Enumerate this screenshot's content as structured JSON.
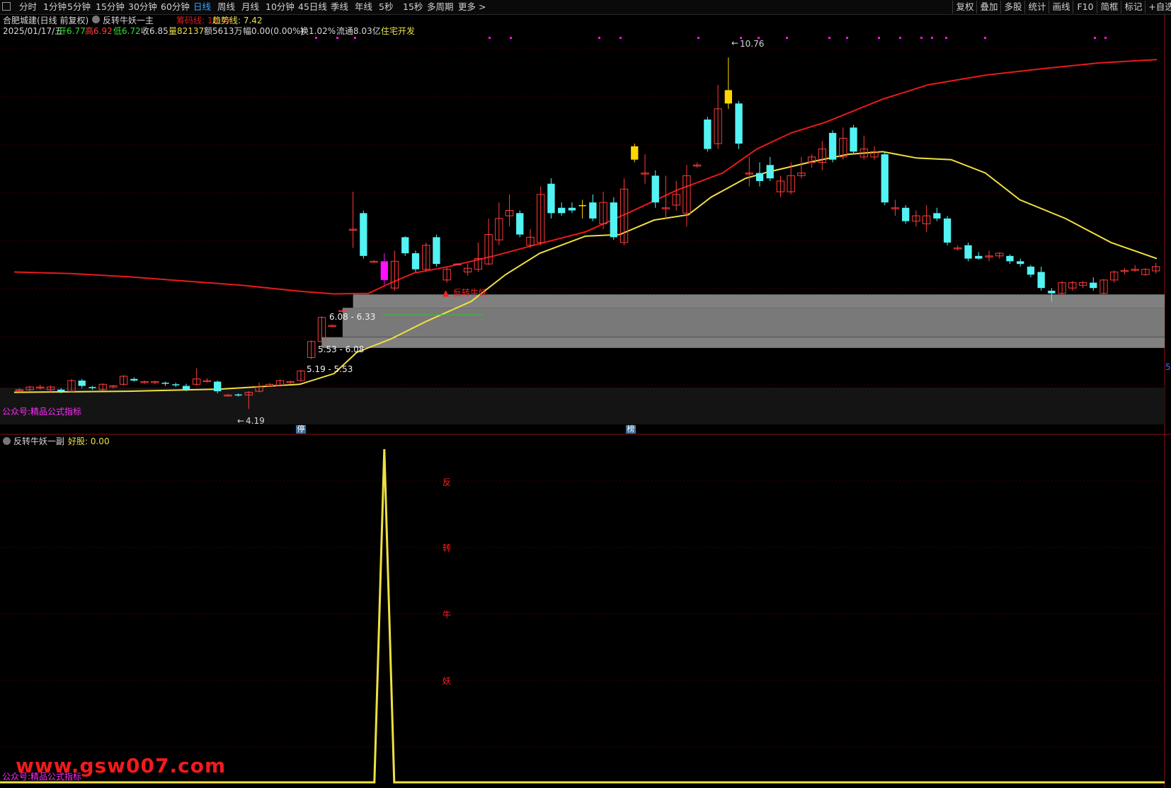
{
  "toolbar": {
    "periods": [
      "分时",
      "1分钟",
      "5分钟",
      "15分钟",
      "30分钟",
      "60分钟",
      "日线",
      "周线",
      "月线",
      "10分钟",
      "45日线",
      "季线",
      "年线",
      "5秒",
      "15秒",
      "多周期",
      "更多 >"
    ],
    "active_period": "日线",
    "right_buttons": [
      "复权",
      "叠加",
      "多股",
      "统计",
      "画线",
      "F10",
      "简框",
      "标记",
      "+自选"
    ]
  },
  "header": {
    "stock": "合肥城建(日线 前复权)",
    "indicator": "反转牛妖一主",
    "cost_label": "筹码线: 10.47",
    "trend_label": "趋势线: 7.42"
  },
  "quote": {
    "date": "2025/01/17/五",
    "open": "开6.77",
    "high": "高6.92",
    "low": "低6.72",
    "close": "收6.85",
    "volume": "量82137",
    "amount": "额5613万",
    "change": "幅0.00(0.00%)",
    "turnover": "换1.02%",
    "float_cap": "流通8.03亿",
    "sector": "住宅开发"
  },
  "annotations": {
    "peak_price": "10.76",
    "low_price": "4.19",
    "signal_label": "反转牛妖",
    "zone_top_label": "6.08 - 6.33",
    "zone_mid_label": "5.53 - 6.08",
    "zone_low_label": "5.19 - 5.53",
    "axis_marker_left": "停",
    "axis_marker_right": "榜",
    "right_edge": "5",
    "watermark_main": "公众号:精品公式指标"
  },
  "sub_panel": {
    "title": "反转牛妖一副",
    "value_label": "好股: 0.00",
    "spike_chars": [
      "反",
      "转",
      "牛",
      "妖"
    ],
    "watermark": "公众号:精品公式指标"
  },
  "site_watermark": "www.gsw007.com",
  "colors": {
    "up": "#ff3b3b",
    "down": "#53f3f3",
    "cost_line": "#e81a1a",
    "trend_line": "#f0e040",
    "highlight_yellow": "#ffd700",
    "highlight_magenta": "#ff10ff",
    "zone_gray": "#808080"
  },
  "chart_data": {
    "type": "candlestick",
    "price_range": [
      3.9,
      11.2
    ],
    "candles": [
      [
        4.55,
        4.55,
        4.5,
        4.58
      ],
      [
        4.55,
        4.6,
        4.52,
        4.62
      ],
      [
        4.6,
        4.6,
        4.55,
        4.64
      ],
      [
        4.55,
        4.6,
        4.5,
        4.63
      ],
      [
        4.55,
        4.52,
        4.48,
        4.58
      ],
      [
        4.52,
        4.72,
        4.5,
        4.75
      ],
      [
        4.72,
        4.62,
        4.58,
        4.75
      ],
      [
        4.6,
        4.58,
        4.55,
        4.62
      ],
      [
        4.55,
        4.65,
        4.53,
        4.67
      ],
      [
        4.6,
        4.62,
        4.57,
        4.64
      ],
      [
        4.65,
        4.8,
        4.62,
        4.82
      ],
      [
        4.75,
        4.72,
        4.7,
        4.78
      ],
      [
        4.7,
        4.7,
        4.66,
        4.72
      ],
      [
        4.68,
        4.7,
        4.65,
        4.72
      ],
      [
        4.68,
        4.66,
        4.62,
        4.7
      ],
      [
        4.65,
        4.64,
        4.6,
        4.68
      ],
      [
        4.62,
        4.55,
        4.52,
        4.66
      ],
      [
        4.65,
        4.75,
        4.62,
        4.95
      ],
      [
        4.72,
        4.72,
        4.68,
        4.76
      ],
      [
        4.7,
        4.52,
        4.48,
        4.72
      ],
      [
        4.45,
        4.45,
        4.42,
        4.47
      ],
      [
        4.46,
        4.45,
        4.42,
        4.48
      ],
      [
        4.45,
        4.5,
        4.19,
        4.52
      ],
      [
        4.52,
        4.6,
        4.5,
        4.68
      ],
      [
        4.62,
        4.65,
        4.6,
        4.67
      ],
      [
        4.62,
        4.72,
        4.6,
        4.74
      ],
      [
        4.68,
        4.7,
        4.66,
        4.72
      ],
      [
        4.72,
        4.9,
        4.7,
        4.92
      ],
      [
        5.15,
        5.45,
        5.12,
        5.47
      ],
      [
        5.45,
        5.9,
        5.43,
        5.92
      ],
      [
        5.75,
        5.75,
        5.73,
        5.77
      ],
      [
        6.03,
        6.03,
        6.01,
        6.05
      ],
      [
        7.55,
        7.55,
        7.2,
        8.25
      ],
      [
        7.85,
        7.05,
        7.0,
        7.9
      ],
      [
        6.95,
        6.95,
        6.93,
        6.97
      ],
      [
        6.6,
        6.95,
        6.5,
        7.1
      ],
      [
        6.45,
        6.95,
        6.4,
        7.15
      ],
      [
        7.4,
        7.1,
        7.05,
        7.42
      ],
      [
        7.1,
        6.8,
        6.75,
        7.15
      ],
      [
        6.8,
        7.25,
        6.75,
        7.3
      ],
      [
        7.4,
        6.9,
        6.85,
        7.45
      ],
      [
        6.6,
        6.8,
        6.55,
        6.85
      ],
      [
        6.9,
        6.9,
        6.88,
        6.92
      ],
      [
        6.75,
        6.82,
        6.68,
        6.9
      ],
      [
        6.8,
        7.0,
        6.75,
        7.3
      ],
      [
        6.9,
        7.45,
        6.88,
        7.75
      ],
      [
        7.35,
        7.75,
        7.25,
        8.05
      ],
      [
        7.8,
        7.9,
        7.6,
        8.2
      ],
      [
        7.85,
        7.45,
        7.4,
        7.9
      ],
      [
        7.25,
        7.4,
        7.2,
        7.55
      ],
      [
        7.3,
        8.2,
        7.25,
        8.35
      ],
      [
        8.4,
        7.85,
        7.75,
        8.5
      ],
      [
        7.95,
        7.85,
        7.8,
        8.05
      ],
      [
        7.95,
        7.9,
        7.85,
        8.05
      ],
      [
        8.0,
        8.0,
        7.75,
        8.1
      ],
      [
        8.05,
        7.75,
        7.7,
        8.2
      ],
      [
        7.65,
        8.05,
        7.55,
        8.25
      ],
      [
        8.05,
        7.4,
        7.35,
        8.15
      ],
      [
        7.3,
        8.3,
        7.25,
        8.5
      ],
      [
        9.1,
        8.85,
        8.8,
        9.15
      ],
      [
        8.6,
        8.6,
        8.4,
        8.95
      ],
      [
        8.55,
        8.05,
        7.95,
        8.65
      ],
      [
        7.95,
        7.95,
        7.75,
        8.55
      ],
      [
        8.0,
        8.2,
        7.9,
        8.45
      ],
      [
        7.85,
        8.55,
        7.6,
        8.75
      ],
      [
        8.75,
        8.75,
        8.7,
        8.8
      ],
      [
        9.6,
        9.05,
        9.0,
        9.65
      ],
      [
        9.15,
        9.8,
        9.05,
        10.25
      ],
      [
        9.9,
        10.15,
        9.8,
        10.76
      ],
      [
        9.9,
        9.15,
        9.05,
        9.95
      ],
      [
        8.6,
        8.6,
        8.35,
        8.9
      ],
      [
        8.6,
        8.45,
        8.35,
        8.8
      ],
      [
        8.75,
        8.5,
        8.45,
        8.9
      ],
      [
        8.25,
        8.45,
        8.15,
        8.55
      ],
      [
        8.25,
        8.55,
        8.2,
        8.8
      ],
      [
        8.55,
        8.6,
        8.5,
        8.9
      ],
      [
        8.8,
        8.9,
        8.7,
        8.95
      ],
      [
        8.8,
        9.05,
        8.65,
        9.2
      ],
      [
        9.35,
        8.85,
        8.8,
        9.4
      ],
      [
        8.9,
        9.25,
        8.85,
        9.45
      ],
      [
        9.45,
        9.0,
        8.95,
        9.5
      ],
      [
        8.9,
        9.05,
        8.85,
        9.3
      ],
      [
        8.9,
        9.0,
        8.85,
        9.1
      ],
      [
        8.95,
        8.05,
        8.0,
        9.0
      ],
      [
        7.95,
        7.95,
        7.8,
        8.1
      ],
      [
        7.95,
        7.7,
        7.65,
        8.0
      ],
      [
        7.7,
        7.8,
        7.6,
        7.9
      ],
      [
        7.65,
        7.8,
        7.5,
        8.0
      ],
      [
        7.85,
        7.75,
        7.7,
        7.95
      ],
      [
        7.75,
        7.3,
        7.25,
        7.8
      ],
      [
        7.2,
        7.2,
        7.15,
        7.25
      ],
      [
        7.25,
        7.0,
        6.95,
        7.3
      ],
      [
        7.05,
        7.0,
        6.98,
        7.12
      ],
      [
        7.05,
        7.05,
        6.95,
        7.15
      ],
      [
        7.05,
        7.1,
        7.0,
        7.12
      ],
      [
        7.05,
        6.95,
        6.9,
        7.08
      ],
      [
        6.95,
        6.9,
        6.85,
        7.0
      ],
      [
        6.85,
        6.7,
        6.65,
        6.88
      ],
      [
        6.75,
        6.45,
        6.4,
        6.85
      ],
      [
        6.4,
        6.35,
        6.2,
        6.45
      ],
      [
        6.35,
        6.55,
        6.3,
        6.58
      ],
      [
        6.45,
        6.55,
        6.4,
        6.58
      ],
      [
        6.5,
        6.55,
        6.45,
        6.58
      ],
      [
        6.55,
        6.45,
        6.4,
        6.65
      ],
      [
        6.35,
        6.6,
        6.3,
        6.62
      ],
      [
        6.6,
        6.75,
        6.55,
        6.78
      ],
      [
        6.78,
        6.78,
        6.7,
        6.82
      ],
      [
        6.8,
        6.8,
        6.75,
        6.88
      ],
      [
        6.7,
        6.8,
        6.68,
        6.82
      ],
      [
        6.77,
        6.85,
        6.72,
        6.92
      ]
    ],
    "cost_line": [
      [
        0,
        6.75
      ],
      [
        0.05,
        6.72
      ],
      [
        0.1,
        6.66
      ],
      [
        0.15,
        6.58
      ],
      [
        0.2,
        6.5
      ],
      [
        0.25,
        6.39
      ],
      [
        0.28,
        6.34
      ],
      [
        0.31,
        6.35
      ],
      [
        0.33,
        6.55
      ],
      [
        0.35,
        6.73
      ],
      [
        0.38,
        6.85
      ],
      [
        0.42,
        7.05
      ],
      [
        0.46,
        7.28
      ],
      [
        0.5,
        7.5
      ],
      [
        0.54,
        7.88
      ],
      [
        0.58,
        8.28
      ],
      [
        0.62,
        8.6
      ],
      [
        0.65,
        9.05
      ],
      [
        0.68,
        9.35
      ],
      [
        0.71,
        9.55
      ],
      [
        0.76,
        9.98
      ],
      [
        0.8,
        10.25
      ],
      [
        0.85,
        10.43
      ],
      [
        0.9,
        10.55
      ],
      [
        0.95,
        10.66
      ],
      [
        1,
        10.72
      ]
    ],
    "trend_line": [
      [
        0,
        4.5
      ],
      [
        0.1,
        4.52
      ],
      [
        0.18,
        4.56
      ],
      [
        0.25,
        4.65
      ],
      [
        0.28,
        4.85
      ],
      [
        0.3,
        5.25
      ],
      [
        0.33,
        5.5
      ],
      [
        0.36,
        5.82
      ],
      [
        0.4,
        6.2
      ],
      [
        0.43,
        6.7
      ],
      [
        0.46,
        7.1
      ],
      [
        0.5,
        7.42
      ],
      [
        0.53,
        7.45
      ],
      [
        0.56,
        7.72
      ],
      [
        0.59,
        7.82
      ],
      [
        0.61,
        8.15
      ],
      [
        0.64,
        8.5
      ],
      [
        0.66,
        8.62
      ],
      [
        0.7,
        8.82
      ],
      [
        0.73,
        8.95
      ],
      [
        0.76,
        9.0
      ],
      [
        0.79,
        8.88
      ],
      [
        0.82,
        8.85
      ],
      [
        0.85,
        8.6
      ],
      [
        0.88,
        8.1
      ],
      [
        0.92,
        7.75
      ],
      [
        0.96,
        7.3
      ],
      [
        1,
        7.0
      ]
    ],
    "zones": [
      {
        "low": 6.08,
        "high": 6.33,
        "label": "6.08 - 6.33"
      },
      {
        "low": 5.53,
        "high": 6.08,
        "label": "5.53 - 6.08"
      }
    ],
    "sub_indicator": {
      "name": "好股",
      "signal_index": 35,
      "peak_value": 1
    }
  }
}
